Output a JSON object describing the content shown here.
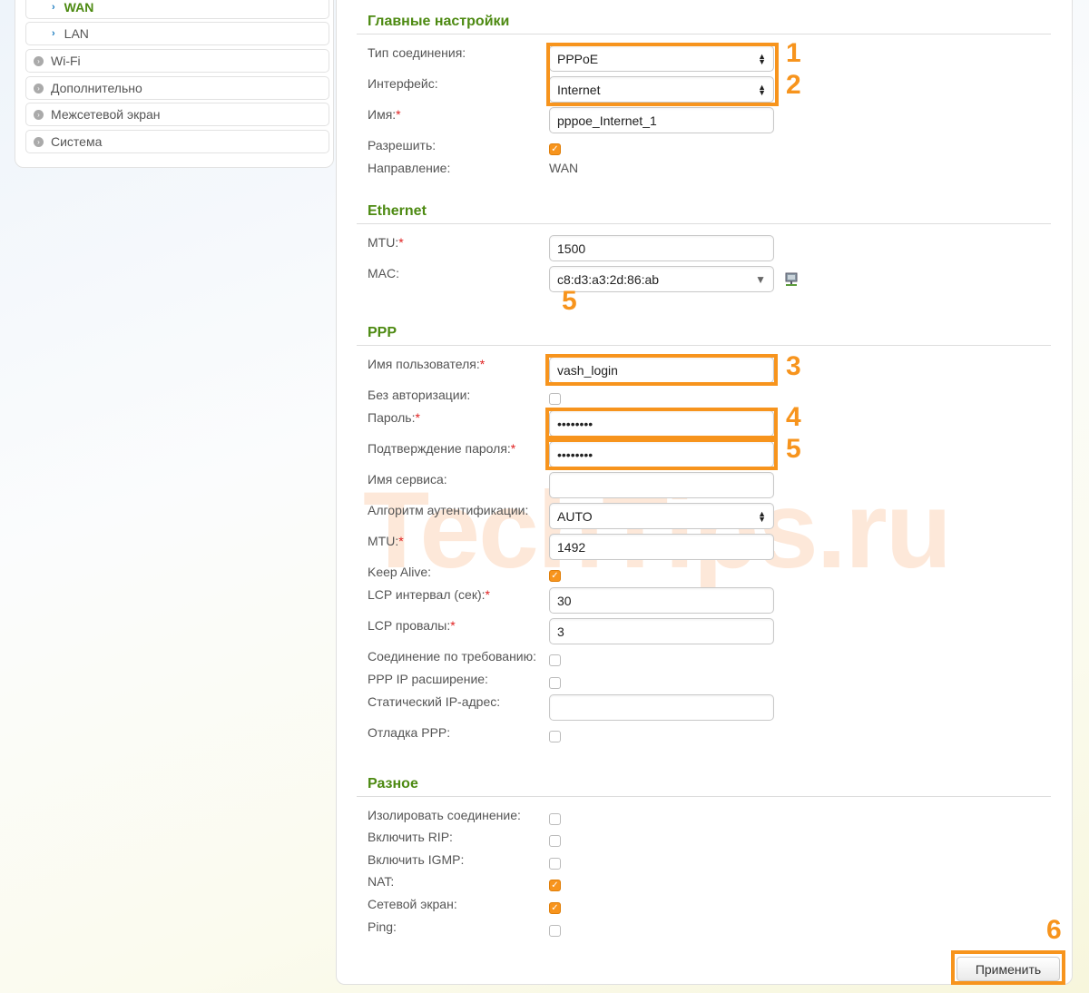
{
  "sidebar": {
    "items": [
      {
        "label": "WAN",
        "kind": "sub",
        "active": true
      },
      {
        "label": "LAN",
        "kind": "sub"
      },
      {
        "label": "Wi-Fi",
        "kind": "top"
      },
      {
        "label": "Дополнительно",
        "kind": "top"
      },
      {
        "label": "Межсетевой экран",
        "kind": "top"
      },
      {
        "label": "Система",
        "kind": "top"
      }
    ]
  },
  "sections": {
    "main": "Главные настройки",
    "ethernet": "Ethernet",
    "ppp": "PPP",
    "misc": "Разное"
  },
  "rows": [
    {
      "label": "Тип соединения:",
      "type": "select",
      "value": "PPPoE"
    },
    {
      "label": "Интерфейс:",
      "type": "select",
      "value": "Internet"
    },
    {
      "label": "Имя:",
      "req": true,
      "type": "input",
      "value": "pppoe_Internet_1"
    },
    {
      "label": "Разрешить:",
      "type": "checkbox",
      "checked": true
    },
    {
      "label": "Направление:",
      "type": "text",
      "value": "WAN"
    },
    {
      "label": "MTU:",
      "req": true,
      "type": "input",
      "value": "1500"
    },
    {
      "label": "MAC:",
      "type": "combo",
      "value": "c8:d3:a3:2d:86:ab"
    },
    {
      "label": "Имя пользователя:",
      "req": true,
      "type": "input",
      "value": "vash_login"
    },
    {
      "label": "Без авторизации:",
      "type": "checkbox",
      "checked": false
    },
    {
      "label": "Пароль:",
      "req": true,
      "type": "input",
      "value": "••••••••"
    },
    {
      "label": "Подтверждение пароля:",
      "req": true,
      "type": "input",
      "value": "••••••••"
    },
    {
      "label": "Имя сервиса:",
      "type": "input",
      "value": ""
    },
    {
      "label": "Алгоритм аутентификации:",
      "type": "select",
      "value": "AUTO"
    },
    {
      "label": "MTU:",
      "req": true,
      "type": "input",
      "value": "1492"
    },
    {
      "label": "Keep Alive:",
      "type": "checkbox",
      "checked": true
    },
    {
      "label": "LCP интервал (сек):",
      "req": true,
      "type": "input",
      "value": "30"
    },
    {
      "label": "LCP провалы:",
      "req": true,
      "type": "input",
      "value": "3"
    },
    {
      "label": "Соединение по требованию:",
      "type": "checkbox",
      "checked": false
    },
    {
      "label": "PPP IP расширение:",
      "type": "checkbox",
      "checked": false
    },
    {
      "label": "Статический IP-адрес:",
      "type": "input",
      "value": ""
    },
    {
      "label": "Отладка PPP:",
      "type": "checkbox",
      "checked": false
    },
    {
      "label": "Изолировать соединение:",
      "type": "checkbox",
      "checked": false
    },
    {
      "label": "Включить RIP:",
      "type": "checkbox",
      "checked": false
    },
    {
      "label": "Включить IGMP:",
      "type": "checkbox",
      "checked": false
    },
    {
      "label": "NAT:",
      "type": "checkbox",
      "checked": true
    },
    {
      "label": "Сетевой экран:",
      "type": "checkbox",
      "checked": true
    },
    {
      "label": "Ping:",
      "type": "checkbox",
      "checked": false
    }
  ],
  "annotations": [
    "1",
    "2",
    "5",
    "3",
    "4",
    "5",
    "6"
  ],
  "watermark": "TechTips.ru",
  "apply_label": "Применить",
  "accent": "#f7941d"
}
